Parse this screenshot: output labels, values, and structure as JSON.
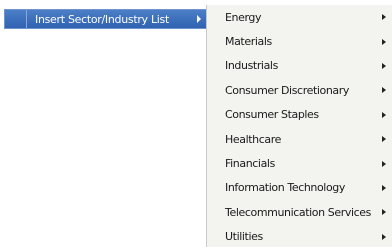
{
  "menu": {
    "parent_item": {
      "label": "Insert Sector/Industry List",
      "icon": "chevron-right-icon"
    },
    "submenu_items": [
      {
        "label": "Energy",
        "icon": "chevron-right-icon"
      },
      {
        "label": "Materials",
        "icon": "chevron-right-icon"
      },
      {
        "label": "Industrials",
        "icon": "chevron-right-icon"
      },
      {
        "label": "Consumer Discretionary",
        "icon": "chevron-right-icon"
      },
      {
        "label": "Consumer Staples",
        "icon": "chevron-right-icon"
      },
      {
        "label": "Healthcare",
        "icon": "chevron-right-icon"
      },
      {
        "label": "Financials",
        "icon": "chevron-right-icon"
      },
      {
        "label": "Information Technology",
        "icon": "chevron-right-icon"
      },
      {
        "label": "Telecommunication Services",
        "icon": "chevron-right-icon"
      },
      {
        "label": "Utilities",
        "icon": "chevron-right-icon"
      }
    ]
  },
  "colors": {
    "highlight": "#2f62b0",
    "submenu_bg": "#f3f3f0",
    "text": "#1a1a1a"
  }
}
